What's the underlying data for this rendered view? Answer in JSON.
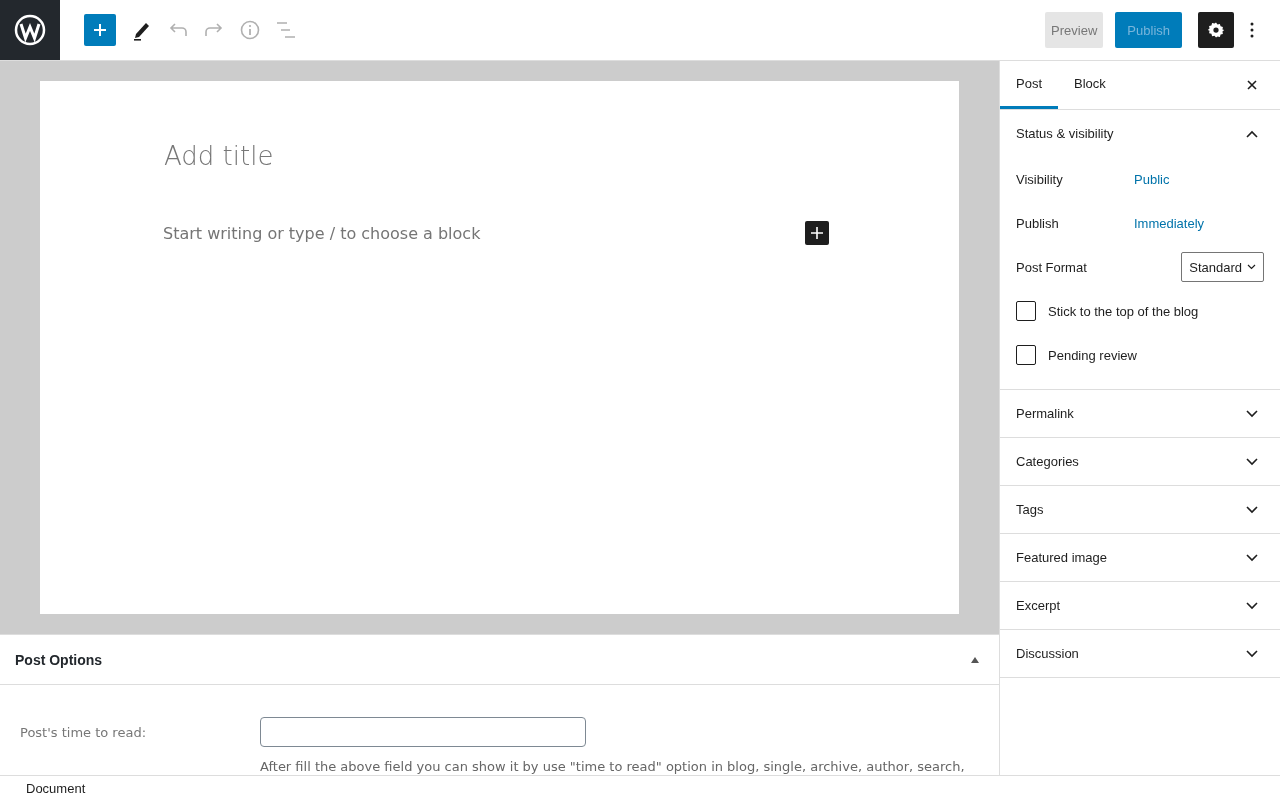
{
  "toolbar": {
    "buttons": [
      {
        "kind": "add",
        "disabled": false
      },
      {
        "kind": "edit",
        "disabled": false
      },
      {
        "kind": "undo",
        "disabled": true
      },
      {
        "kind": "redo",
        "disabled": true
      },
      {
        "kind": "info",
        "disabled": true
      },
      {
        "kind": "outline",
        "disabled": true
      }
    ],
    "preview": "Preview",
    "publish": "Publish",
    "settings_on": true
  },
  "editor": {
    "title_placeholder": "Add title",
    "body_placeholder": "Start writing or type / to choose a block"
  },
  "post_options": {
    "title": "Post Options",
    "expanded": true,
    "fields": [
      {
        "label": "Post's time to read:",
        "help": "After fill the above field you can show it by use \"time to read\" option in blog, single, archive, author, search,"
      }
    ]
  },
  "sidebar": {
    "tabs": [
      {
        "label": "Post",
        "selected": true
      },
      {
        "label": "Block",
        "selected": false
      }
    ],
    "sections": [
      {
        "title": "Status & visibility",
        "expanded": true,
        "rows": [
          {
            "kind": "link",
            "label": "Visibility",
            "value": "Public"
          },
          {
            "kind": "link",
            "label": "Publish",
            "value": "Immediately"
          },
          {
            "kind": "select",
            "label": "Post Format",
            "value": "Standard"
          },
          {
            "kind": "checkbox",
            "label": "Stick to the top of the blog",
            "checked": false
          },
          {
            "kind": "checkbox",
            "label": "Pending review",
            "checked": false
          }
        ]
      },
      {
        "title": "Permalink",
        "expanded": false
      },
      {
        "title": "Categories",
        "expanded": false
      },
      {
        "title": "Tags",
        "expanded": false
      },
      {
        "title": "Featured image",
        "expanded": false
      },
      {
        "title": "Excerpt",
        "expanded": false
      },
      {
        "title": "Discussion",
        "expanded": false
      }
    ]
  },
  "footer": {
    "breadcrumb": "Document"
  }
}
